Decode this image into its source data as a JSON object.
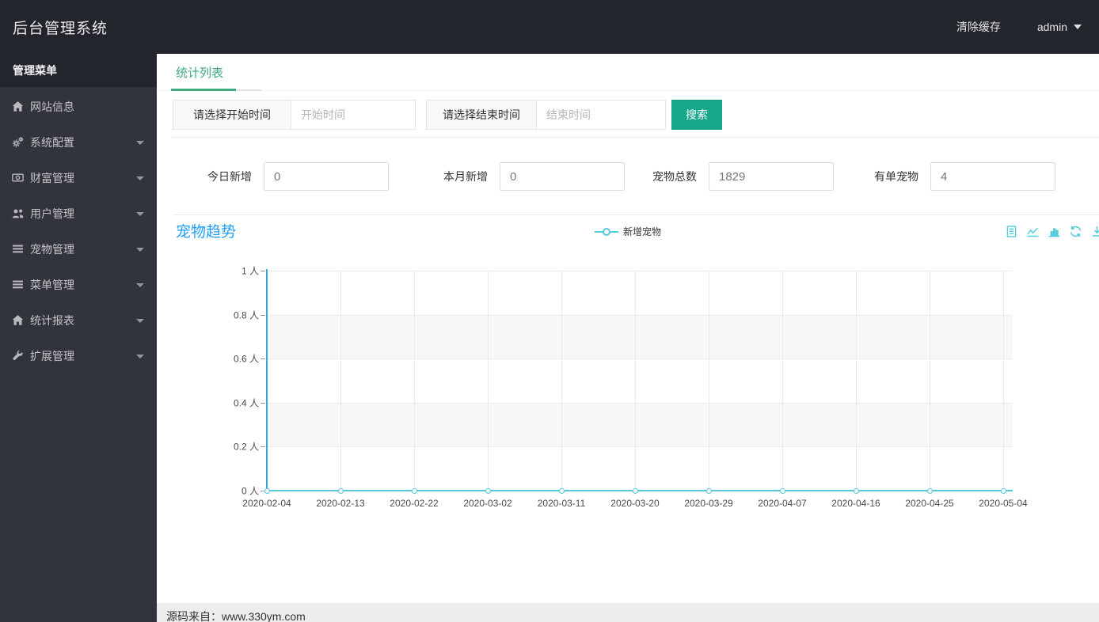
{
  "header": {
    "title": "后台管理系统",
    "clear_cache_label": "清除缓存",
    "user_label": "admin"
  },
  "sidebar": {
    "menu_title": "管理菜单",
    "items": [
      {
        "id": "site-info",
        "label": "网站信息",
        "icon": "home-icon",
        "has_arrow": false
      },
      {
        "id": "system-config",
        "label": "系统配置",
        "icon": "cogs-icon",
        "has_arrow": true
      },
      {
        "id": "wealth",
        "label": "财富管理",
        "icon": "money-icon",
        "has_arrow": true
      },
      {
        "id": "users",
        "label": "用户管理",
        "icon": "users-icon",
        "has_arrow": true
      },
      {
        "id": "pets",
        "label": "宠物管理",
        "icon": "list-icon",
        "has_arrow": true
      },
      {
        "id": "menus",
        "label": "菜单管理",
        "icon": "list-icon",
        "has_arrow": true
      },
      {
        "id": "reports",
        "label": "统计报表",
        "icon": "home-icon",
        "has_arrow": true
      },
      {
        "id": "extensions",
        "label": "扩展管理",
        "icon": "wrench-icon",
        "has_arrow": true
      }
    ]
  },
  "tabs": {
    "active_label": "统计列表"
  },
  "filter": {
    "start_addon": "请选择开始时间",
    "start_placeholder": "开始时间",
    "end_addon": "请选择结束时间",
    "end_placeholder": "结束时间",
    "search_label": "搜索"
  },
  "stats": [
    {
      "label": "今日新增",
      "value": "0"
    },
    {
      "label": "本月新增",
      "value": "0"
    },
    {
      "label": "宠物总数",
      "value": "1829"
    },
    {
      "label": "有单宠物",
      "value": "4"
    }
  ],
  "chart_section": {
    "title": "宠物趋势",
    "legend_label": "新增宠物",
    "toolbox_icons": [
      "data-view-icon",
      "line-type-icon",
      "bar-type-icon",
      "restore-icon",
      "save-image-icon"
    ]
  },
  "chart_data": {
    "type": "line",
    "title": "宠物趋势",
    "x": [
      "2020-02-04",
      "2020-02-13",
      "2020-02-22",
      "2020-03-02",
      "2020-03-11",
      "2020-03-20",
      "2020-03-29",
      "2020-04-07",
      "2020-04-16",
      "2020-04-25",
      "2020-05-04"
    ],
    "series": [
      {
        "name": "新增宠物",
        "values": [
          0,
          0,
          0,
          0,
          0,
          0,
          0,
          0,
          0,
          0,
          0
        ]
      }
    ],
    "y_ticks": [
      "1 人",
      "0.8 人",
      "0.6 人",
      "0.4 人",
      "0.2 人",
      "0 人"
    ],
    "ylim": [
      0,
      1
    ],
    "ylabel": "人",
    "xlabel": "",
    "grid": true,
    "split_area": "horizontal-bands",
    "legend_position": "top-center"
  },
  "footer": {
    "text": "源码来自：www.330ym.com"
  },
  "colors": {
    "topbar_bg": "#22252b",
    "sidebar_bg": "#31343b",
    "tab_green": "#3fa87e",
    "button_teal": "#17a68c",
    "title_blue": "#1e9fff",
    "axis_blue": "#3ba6dc",
    "series_cyan": "#55c9d9",
    "toolbox_cyan": "#4fcbda",
    "footer_bg": "#ededed"
  }
}
